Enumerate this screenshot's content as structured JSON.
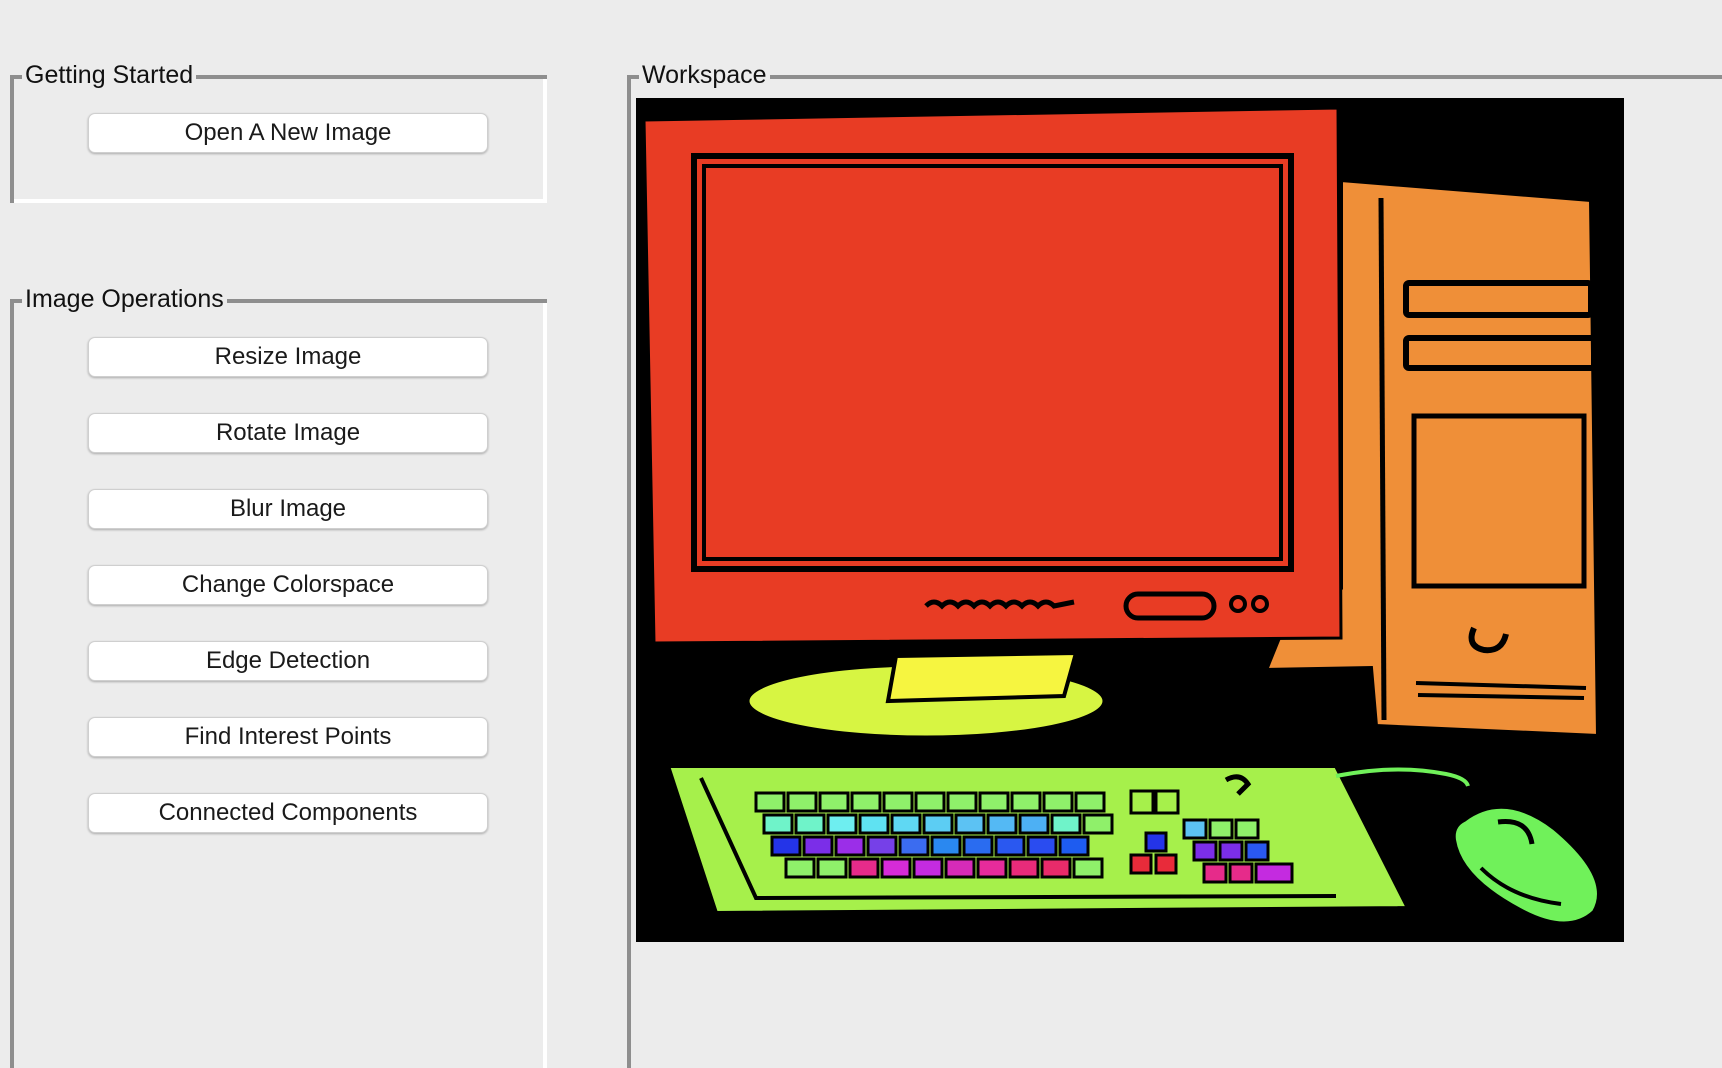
{
  "getting_started": {
    "title": "Getting Started",
    "open_button": "Open A New Image"
  },
  "image_operations": {
    "title": "Image Operations",
    "buttons": [
      "Resize Image",
      "Rotate Image",
      "Blur Image",
      "Change Colorspace",
      "Edge Detection",
      "Find Interest Points",
      "Connected Components"
    ]
  },
  "workspace": {
    "title": "Workspace",
    "image_description_icon": "computer-illustration-icon"
  },
  "colors": {
    "background": "#ececec",
    "monitor": "#e83c24",
    "tower": "#ef8f38",
    "keyboard": "#a6f04b",
    "stand": "#f6f540",
    "mouse": "#70f15a",
    "image_bg": "#000000"
  }
}
